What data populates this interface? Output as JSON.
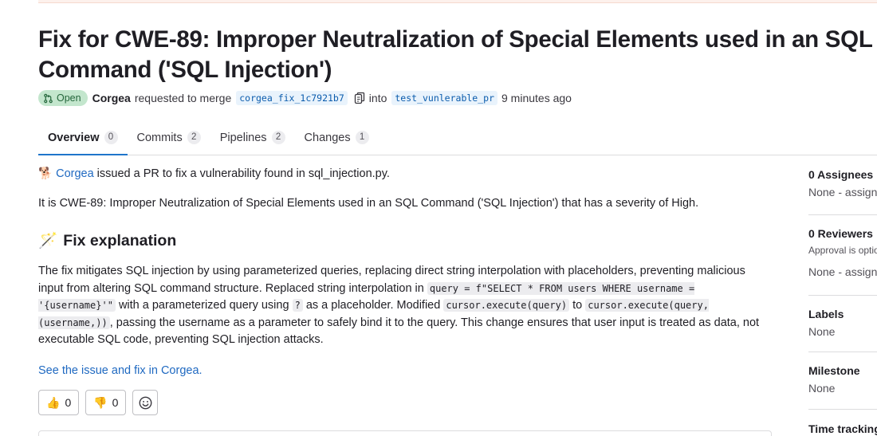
{
  "title": "Fix for CWE-89: Improper Neutralization of Special Elements used in an SQL Command ('SQL Injection')",
  "meta": {
    "status": "Open",
    "author": "Corgea",
    "requested": "requested to merge",
    "source_branch": "corgea_fix_1c7921b7",
    "into": "into",
    "target_branch": "test_vunlerable_pr",
    "time": "9 minutes ago"
  },
  "tabs": [
    {
      "label": "Overview",
      "count": "0"
    },
    {
      "label": "Commits",
      "count": "2"
    },
    {
      "label": "Pipelines",
      "count": "2"
    },
    {
      "label": "Changes",
      "count": "1"
    }
  ],
  "body": {
    "intro_emoji": "🐕",
    "intro_link": "Corgea",
    "intro_rest": " issued a PR to fix a vulnerability found in sql_injection.py.",
    "cwe_line": "It is CWE-89: Improper Neutralization of Special Elements used in an SQL Command ('SQL Injection') that has a severity of High.",
    "heading_emoji": "🪄",
    "heading": "Fix explanation",
    "explain_1": "The fix mitigates SQL injection by using parameterized queries, replacing direct string interpolation with placeholders, preventing malicious input from altering SQL command structure. Replaced string interpolation in ",
    "code_1": "query = f\"SELECT * FROM users WHERE username = '{username}'\"",
    "explain_2": " with a parameterized query using ",
    "code_2": "?",
    "explain_3": " as a placeholder. Modified ",
    "code_3": "cursor.execute(query)",
    "explain_4": " to ",
    "code_4": "cursor.execute(query, (username,))",
    "explain_5": ", passing the username as a parameter to safely bind it to the query. This change ensures that user input is treated as data, not executable SQL code, preventing SQL injection attacks.",
    "see_link": "See the issue and fix in Corgea."
  },
  "reactions": {
    "thumbs_up": "👍",
    "thumbs_up_count": "0",
    "thumbs_down": "👎",
    "thumbs_down_count": "0"
  },
  "sidebar": {
    "assignees_title": "0 Assignees",
    "assignees_val": "None - assign yourself",
    "reviewers_title": "0 Reviewers",
    "reviewers_sub": "Approval is optional",
    "reviewers_val": "None - assign yourself",
    "labels_title": "Labels",
    "labels_val": "None",
    "milestone_title": "Milestone",
    "milestone_val": "None",
    "time_title": "Time tracking"
  }
}
